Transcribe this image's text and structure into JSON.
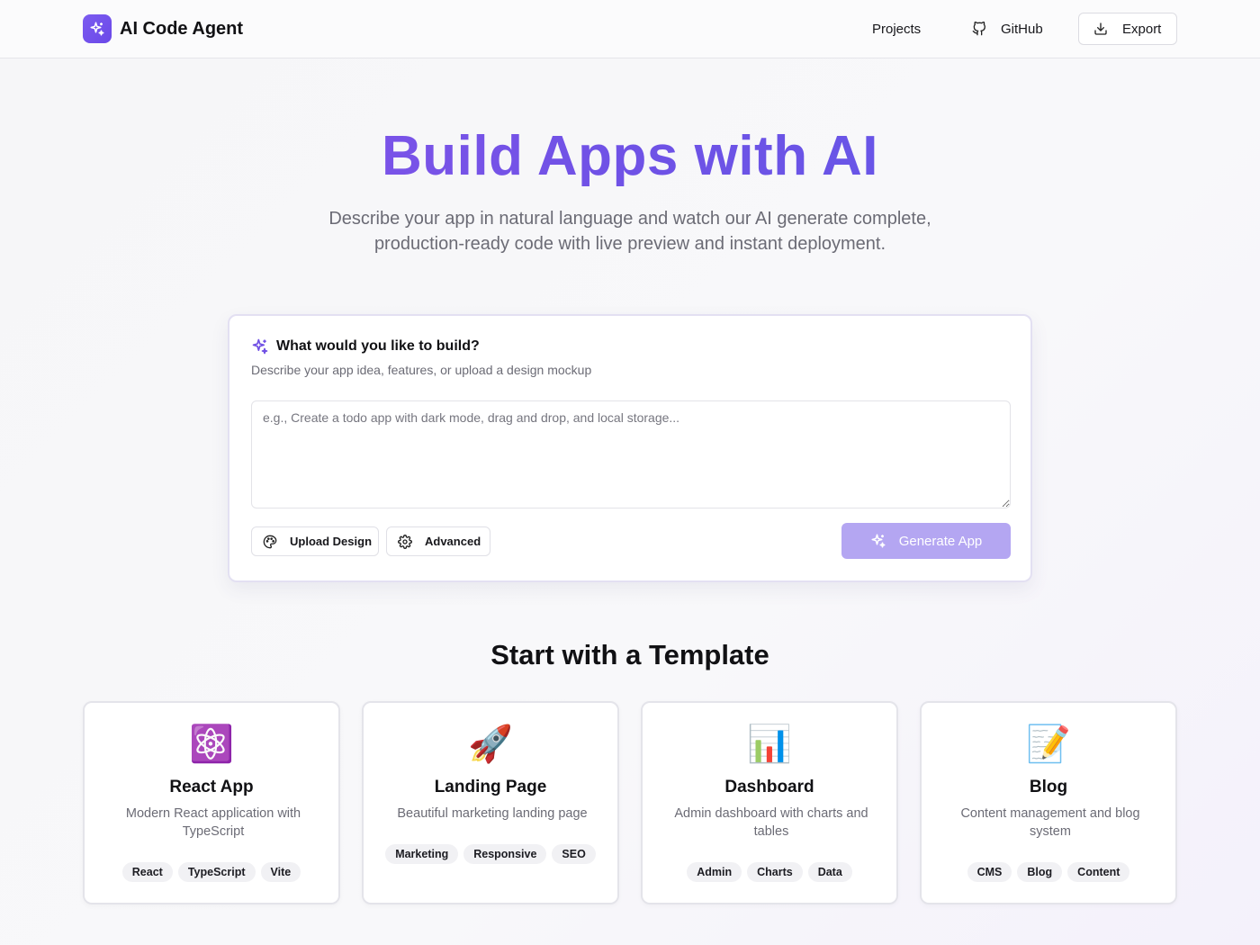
{
  "app": {
    "name": "AI Code Agent",
    "logo_icon": "sparkles-icon"
  },
  "nav": {
    "projects": "Projects",
    "github": "GitHub",
    "export": "Export"
  },
  "hero": {
    "title": "Build Apps with AI",
    "subtitle_line1": "Describe your app in natural language and watch our AI generate complete,",
    "subtitle_line2": "production-ready code with live preview and instant deployment."
  },
  "prompt": {
    "title": "What would you like to build?",
    "description": "Describe your app idea, features, or upload a design mockup",
    "placeholder": "e.g., Create a todo app with dark mode, drag and drop, and local storage...",
    "value": "",
    "upload_label": "Upload Design",
    "advanced_label": "Advanced",
    "generate_label": "Generate App"
  },
  "templates": {
    "heading": "Start with a Template",
    "items": [
      {
        "emoji": "⚛️",
        "name": "React App",
        "desc": "Modern React application with TypeScript",
        "tags": [
          "React",
          "TypeScript",
          "Vite"
        ]
      },
      {
        "emoji": "🚀",
        "name": "Landing Page",
        "desc": "Beautiful marketing landing page",
        "tags": [
          "Marketing",
          "Responsive",
          "SEO"
        ]
      },
      {
        "emoji": "📊",
        "name": "Dashboard",
        "desc": "Admin dashboard with charts and tables",
        "tags": [
          "Admin",
          "Charts",
          "Data"
        ]
      },
      {
        "emoji": "📝",
        "name": "Blog",
        "desc": "Content management and blog system",
        "tags": [
          "CMS",
          "Blog",
          "Content"
        ]
      }
    ]
  },
  "colors": {
    "accent": "#7050e4",
    "generate_disabled": "#b4a6f2"
  }
}
